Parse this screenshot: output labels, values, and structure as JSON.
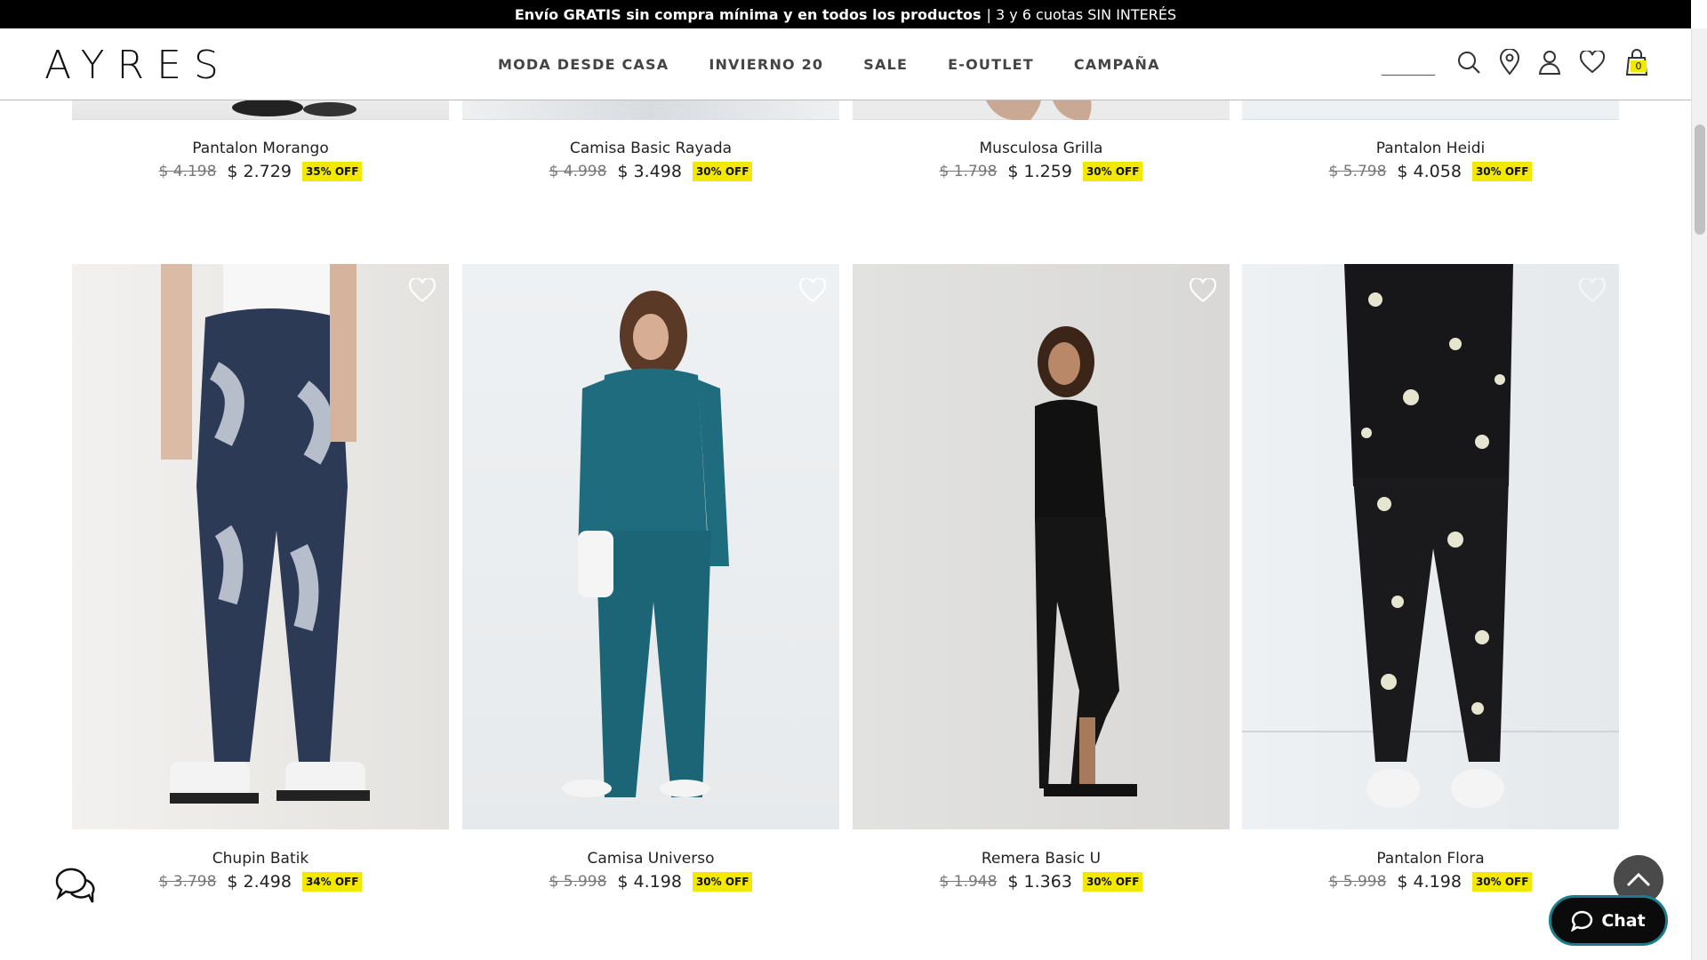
{
  "promo": {
    "bold": "Envío GRATIS sin compra mínima y en todos los productos",
    "rest": "| 3 y 6 cuotas SIN INTERÉS"
  },
  "header": {
    "logo": "AYRES",
    "cart_count": "0"
  },
  "nav": [
    {
      "label": "MODA DESDE CASA"
    },
    {
      "label": "INVIERNO 20"
    },
    {
      "label": "SALE"
    },
    {
      "label": "E-OUTLET"
    },
    {
      "label": "CAMPAÑA"
    }
  ],
  "row1": [
    {
      "name": "Pantalon Morango",
      "old": "$ 4.198",
      "new": "$ 2.729",
      "off": "35% OFF"
    },
    {
      "name": "Camisa Basic Rayada",
      "old": "$ 4.998",
      "new": "$ 3.498",
      "off": "30% OFF"
    },
    {
      "name": "Musculosa Grilla",
      "old": "$ 1.798",
      "new": "$ 1.259",
      "off": "30% OFF"
    },
    {
      "name": "Pantalon Heidi",
      "old": "$ 5.798",
      "new": "$ 4.058",
      "off": "30% OFF"
    }
  ],
  "row2": [
    {
      "name": "Chupin Batik",
      "old": "$ 3.798",
      "new": "$ 2.498",
      "off": "34% OFF"
    },
    {
      "name": "Camisa Universo",
      "old": "$ 5.998",
      "new": "$ 4.198",
      "off": "30% OFF"
    },
    {
      "name": "Remera Basic U",
      "old": "$ 1.948",
      "new": "$ 1.363",
      "off": "30% OFF"
    },
    {
      "name": "Pantalon Flora",
      "old": "$ 5.998",
      "new": "$ 4.198",
      "off": "30% OFF"
    }
  ],
  "chat": {
    "label": "Chat"
  },
  "colors": {
    "badge": "#f2e800",
    "topbar": "#000000"
  }
}
